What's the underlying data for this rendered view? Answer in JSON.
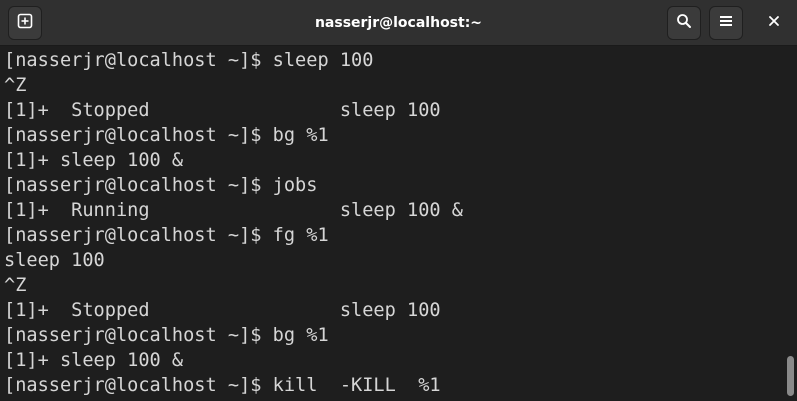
{
  "window": {
    "title": "nasserjr@localhost:~"
  },
  "header": {
    "buttons": [
      {
        "icon": "new-tab-icon"
      },
      {
        "icon": "search-icon"
      },
      {
        "icon": "hamburger-menu-icon"
      },
      {
        "icon": "close-icon"
      }
    ]
  },
  "terminal": {
    "lines": [
      "[nasserjr@localhost ~]$ sleep 100",
      "^Z",
      "[1]+  Stopped                 sleep 100",
      "[nasserjr@localhost ~]$ bg %1",
      "[1]+ sleep 100 &",
      "[nasserjr@localhost ~]$ jobs",
      "[1]+  Running                 sleep 100 &",
      "[nasserjr@localhost ~]$ fg %1",
      "sleep 100",
      "^Z",
      "[1]+  Stopped                 sleep 100",
      "[nasserjr@localhost ~]$ bg %1",
      "[1]+ sleep 100 &",
      "[nasserjr@localhost ~]$ kill  -KILL  %1"
    ]
  },
  "colors": {
    "background": "#1e1e1e",
    "titlebar": "#303030",
    "text": "#d6d6d6"
  }
}
